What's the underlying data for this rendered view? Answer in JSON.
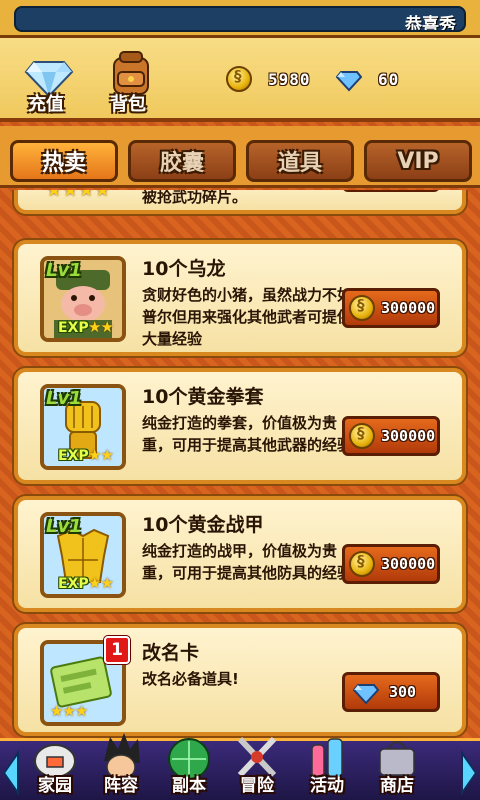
{
  "marquee": {
    "text": "恭喜秀"
  },
  "header": {
    "recharge_label": "充值",
    "bag_label": "背包",
    "coins": "5980",
    "gems": "60"
  },
  "tabs": [
    {
      "label": "热卖",
      "active": true
    },
    {
      "label": "胶囊",
      "active": false
    },
    {
      "label": "道具",
      "active": false
    },
    {
      "label": "VIP",
      "active": false
    }
  ],
  "items": [
    {
      "partial_desc": "被抢武功碎片。"
    },
    {
      "title": "10个乌龙",
      "level": "Lv1",
      "exp": "EXP",
      "desc": "贪财好色的小猪，虽然战力不如普尔但用来强化其他武者可提供大量经验",
      "price": "300000",
      "currency": "coin"
    },
    {
      "title": "10个黄金拳套",
      "level": "Lv1",
      "exp": "EXP",
      "desc": "纯金打造的拳套，价值极为贵重，可用于提高其他武器的经验",
      "price": "300000",
      "currency": "coin"
    },
    {
      "title": "10个黄金战甲",
      "level": "Lv1",
      "exp": "EXP",
      "desc": "纯金打造的战甲，价值极为贵重，可用于提高其他防具的经验",
      "price": "300000",
      "currency": "coin"
    },
    {
      "title": "改名卡",
      "badge": "1",
      "desc": "改名必备道具!",
      "price": "300",
      "currency": "gem"
    }
  ],
  "stars": {
    "three": "★★★",
    "two": "★★",
    "four": "★★★★"
  },
  "bottom_nav": [
    {
      "label": "家园",
      "icon": "home-icon"
    },
    {
      "label": "阵容",
      "icon": "team-icon"
    },
    {
      "label": "副本",
      "icon": "dungeon-icon"
    },
    {
      "label": "冒险",
      "icon": "adventure-icon"
    },
    {
      "label": "活动",
      "icon": "event-icon"
    },
    {
      "label": "商店",
      "icon": "shop-icon"
    }
  ],
  "colors": {
    "accent": "#e5761a",
    "card_border": "#d9881f",
    "nav_bg": "#3b2a7a"
  }
}
